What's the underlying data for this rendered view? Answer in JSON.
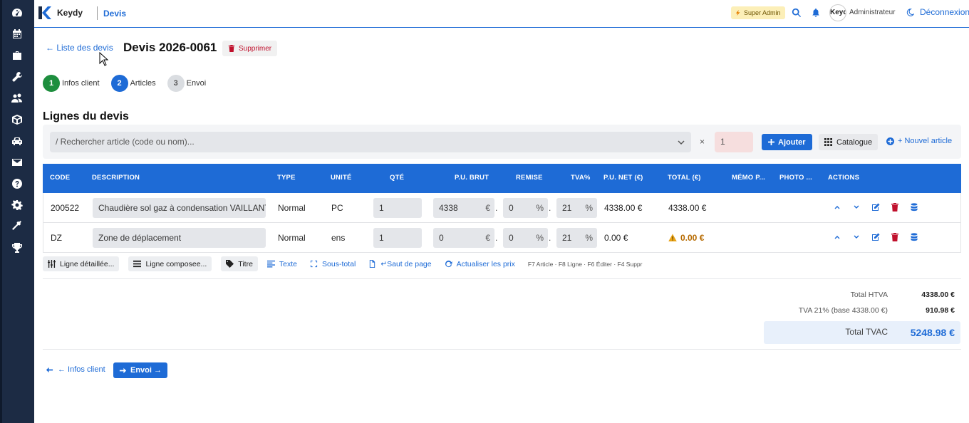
{
  "app": {
    "brand": "Keydy",
    "nav_current": "Devis",
    "role_badge": "Super Admin",
    "avatar_text": "Keydy",
    "user_label": "Administrateur",
    "logout_label": "Déconnexion"
  },
  "sidebar": {
    "icons": [
      "dashboard-icon",
      "calendar-icon",
      "briefcase-icon",
      "wrench-icon",
      "users-icon",
      "box-icon",
      "car-icon",
      "mail-icon",
      "help-icon",
      "gear-icon",
      "tools-icon",
      "trophy-icon"
    ]
  },
  "header": {
    "back_label": "← Liste des devis",
    "title": "Devis 2026-0061",
    "delete_label": "Supprimer"
  },
  "steps": [
    {
      "num": "1",
      "label": "Infos client",
      "state": "done"
    },
    {
      "num": "2",
      "label": "Articles",
      "state": "active"
    },
    {
      "num": "3",
      "label": "Envoi",
      "state": "todo"
    }
  ],
  "lines": {
    "section_title": "Lignes du devis",
    "search_placeholder": "/ Rechercher article (code ou nom)...",
    "times": "×",
    "qty_value": "1",
    "add_label": "Ajouter",
    "catalog_label": "Catalogue",
    "new_article_label": "+ Nouvel article"
  },
  "table": {
    "headers": {
      "code": "CODE",
      "description": "DESCRIPTION",
      "type": "TYPE",
      "unit": "UNITÉ",
      "qty": "QTÉ",
      "pu_brut": "P.U. BRUT",
      "remise": "REMISE",
      "tva": "TVA%",
      "pu_net": "P.U. NET (€)",
      "total": "TOTAL (€)",
      "memo": "MÉMO P...",
      "photo": "PHOTO ...",
      "actions": "ACTIONS"
    },
    "currency_symbol": "€",
    "percent_symbol": "%",
    "rows": [
      {
        "code": "200522",
        "description": "Chaudière sol gaz à condensation VAILLANT",
        "type": "Normal",
        "unit": "PC",
        "qty": "1",
        "pu_brut": "4338",
        "remise": "0",
        "tva": "21",
        "pu_net": "4338.00 €",
        "total": "4338.00 €",
        "warning": false
      },
      {
        "code": "DZ",
        "description": "Zone de déplacement",
        "type": "Normal",
        "unit": "ens",
        "qty": "1",
        "pu_brut": "0",
        "remise": "0",
        "tva": "21",
        "pu_net": "0.00 €",
        "total": "0.00 €",
        "warning": true
      }
    ]
  },
  "toolbar": {
    "detailed_line": "Ligne détaillée...",
    "composed_line": "Ligne composee...",
    "title": "Titre",
    "text": "Texte",
    "subtotal": "Sous-total",
    "page_break": "↵Saut de page",
    "refresh_prices": "Actualiser les prix",
    "shortcuts": "F7 Article · F8 Ligne · F6 Éditer · F4 Suppr"
  },
  "totals": {
    "htva_label": "Total HTVA",
    "htva_value": "4338.00 €",
    "tva_label": "TVA 21% (base 4338.00 €)",
    "tva_value": "910.98 €",
    "tvac_label": "Total TVAC",
    "tvac_value": "5248.98 €"
  },
  "footer": {
    "prev_label": "← Infos client",
    "next_label": "Envoi →"
  },
  "colors": {
    "accent": "#1e6bd6",
    "sidebar": "#1c2b44",
    "danger": "#c0102c",
    "success": "#1e8e3e",
    "warning": "#e8a317"
  }
}
